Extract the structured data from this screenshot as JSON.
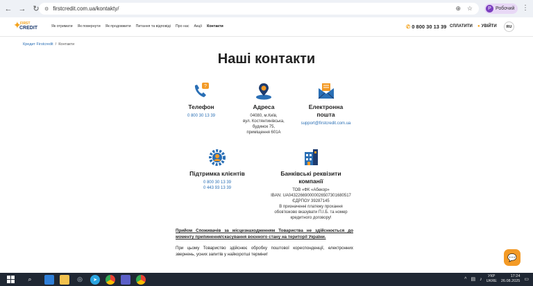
{
  "browser": {
    "url": "firstcredit.com.ua/kontakty/",
    "profile_initial": "P",
    "profile_label": "Робочий"
  },
  "header": {
    "logo_first": "FIRST",
    "logo_credit": "CREDIT",
    "nav": [
      {
        "label": "Як отримати"
      },
      {
        "label": "Як повернути"
      },
      {
        "label": "Як продовжити"
      },
      {
        "label": "Питання та відповіді"
      },
      {
        "label": "Про нас"
      },
      {
        "label": "Акції"
      },
      {
        "label": "Контакти"
      }
    ],
    "phone": "0 800 30 13 39",
    "pay": "СПЛАТИТИ",
    "login": "УВІЙТИ",
    "lang": "RU"
  },
  "breadcrumb": {
    "home": "Кредит Firstcredit",
    "sep": "/",
    "current": "Контакти"
  },
  "page_title": "Наші контакти",
  "cards": {
    "phone": {
      "title": "Телефон",
      "value": "0 800 30 13 39"
    },
    "address": {
      "title": "Адреса",
      "lines": [
        "04080, м.Київ,",
        "вул. Костянтинівська,",
        "будинок 75,",
        "приміщення 601А"
      ]
    },
    "email": {
      "title_1": "Електронна",
      "title_2": "пошта",
      "value": "support@firstcredit.com.ua"
    },
    "support": {
      "title": "Підтримка клієнтів",
      "phones": [
        "0 800 30 13 39",
        "0 443 93 13 39"
      ]
    },
    "bank": {
      "title_1": "Банківські реквізити",
      "title_2": "компанії",
      "lines": [
        "ТОВ «ФК «Абекор»",
        "IBAN: UA043226690000026507301680517",
        "ЄДРПОУ 39287145",
        "В призначенні платежу прохання",
        "обов'язково вказувати П.І.Б. та номер",
        "кредитного договору!"
      ]
    }
  },
  "notice": {
    "bold": "Прийом Споживачів за місцезнаходженням Товариства не здійснюється до моменту припинення/скасування воєнного стану на території України.",
    "normal": "При цьому Товариство здійснює обробку поштової кореспонденції, електронних звернень, усних запитів у найкоротші терміни!"
  },
  "taskbar": {
    "lang_1": "УКР",
    "lang_2": "UKRE",
    "time": "17:24",
    "date": "26.08.2025"
  },
  "colors": {
    "accent_orange": "#f39a26",
    "brand_blue": "#1d3b6e",
    "link_blue": "#2a6fb5"
  }
}
